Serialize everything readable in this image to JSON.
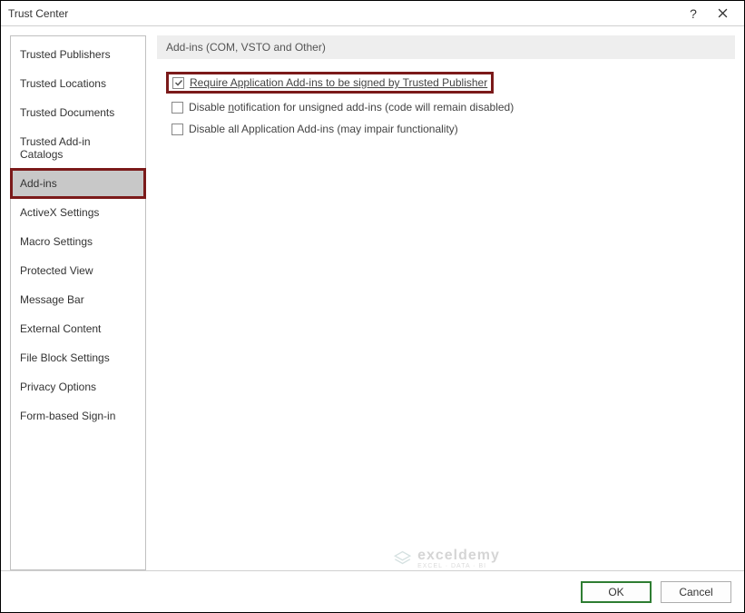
{
  "titlebar": {
    "title": "Trust Center",
    "help": "?",
    "close": "×"
  },
  "sidebar": {
    "items": [
      {
        "label": "Trusted Publishers",
        "selected": false,
        "highlight": false
      },
      {
        "label": "Trusted Locations",
        "selected": false,
        "highlight": false
      },
      {
        "label": "Trusted Documents",
        "selected": false,
        "highlight": false
      },
      {
        "label": "Trusted Add-in Catalogs",
        "selected": false,
        "highlight": false
      },
      {
        "label": "Add-ins",
        "selected": true,
        "highlight": true
      },
      {
        "label": "ActiveX Settings",
        "selected": false,
        "highlight": false
      },
      {
        "label": "Macro Settings",
        "selected": false,
        "highlight": false
      },
      {
        "label": "Protected View",
        "selected": false,
        "highlight": false
      },
      {
        "label": "Message Bar",
        "selected": false,
        "highlight": false
      },
      {
        "label": "External Content",
        "selected": false,
        "highlight": false
      },
      {
        "label": "File Block Settings",
        "selected": false,
        "highlight": false
      },
      {
        "label": "Privacy Options",
        "selected": false,
        "highlight": false
      },
      {
        "label": "Form-based Sign-in",
        "selected": false,
        "highlight": false
      }
    ]
  },
  "main": {
    "section_header": "Add-ins (COM, VSTO and Other)",
    "option1_pre": "",
    "option1_u": "R",
    "option1_post": "equire Application Add-ins to be signed by Trusted Publisher",
    "option1_checked": true,
    "option1_highlight": true,
    "option2_pre": "Disable ",
    "option2_u": "n",
    "option2_post": "otification for unsigned add-ins (code will remain disabled)",
    "option2_checked": false,
    "option3_pre": "Disable all Application Add-ins (may impair functionality)",
    "option3_u": "",
    "option3_post": "",
    "option3_checked": false
  },
  "watermark": {
    "name": "exceldemy",
    "tagline": "EXCEL · DATA · BI"
  },
  "footer": {
    "ok": "OK",
    "cancel": "Cancel"
  }
}
